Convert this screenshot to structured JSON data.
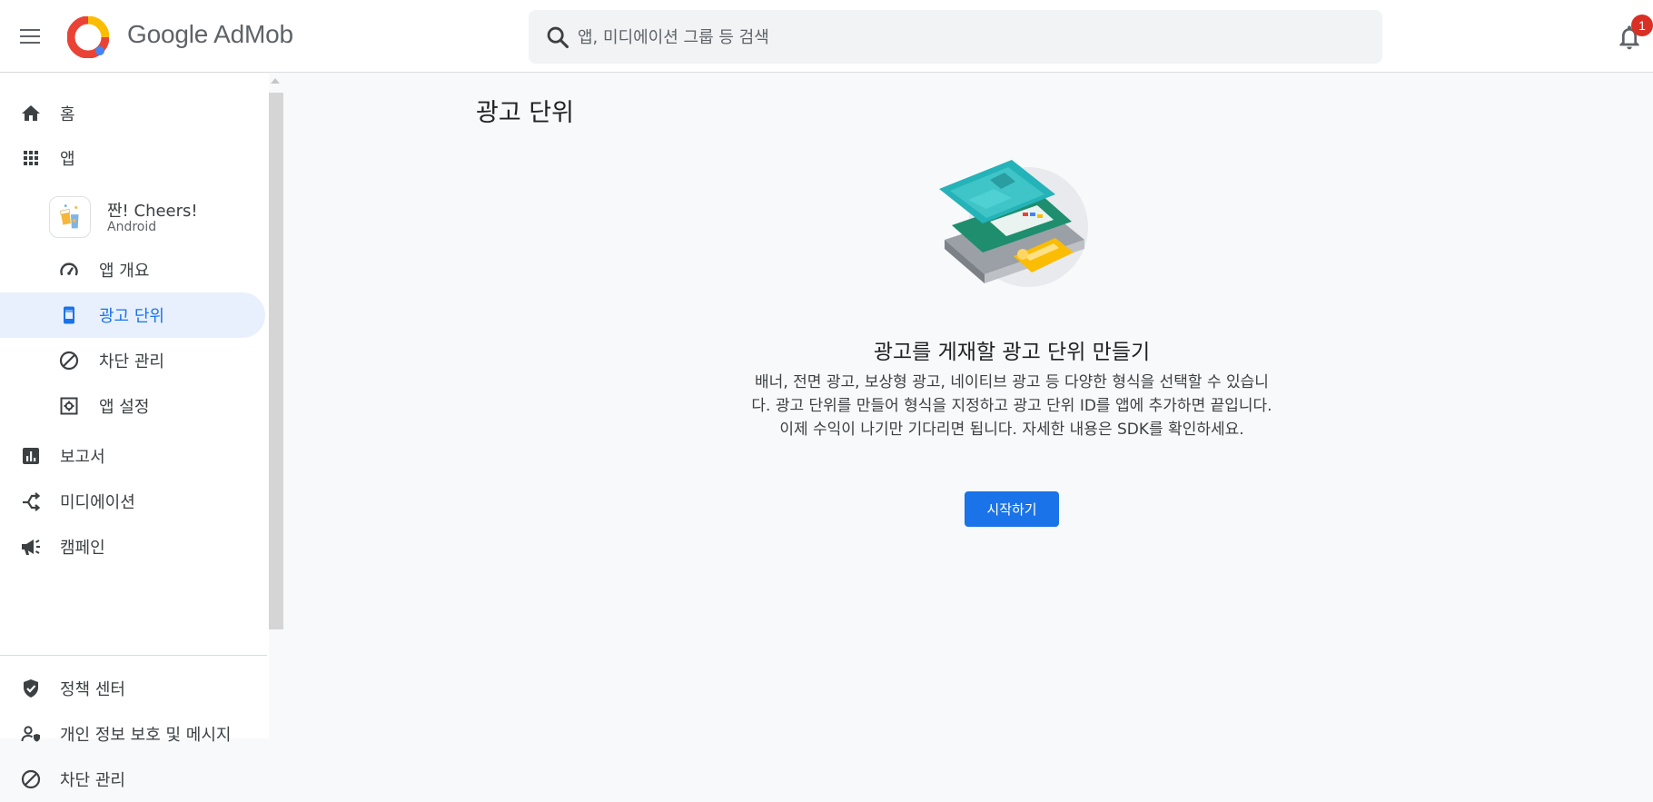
{
  "header": {
    "brand": "Google AdMob",
    "search_placeholder": "앱, 미디에이션 그룹 등 검색",
    "notification_count": "1"
  },
  "sidebar": {
    "home": "홈",
    "apps": "앱",
    "app": {
      "name": "짠! Cheers!",
      "platform": "Android"
    },
    "app_overview": "앱 개요",
    "ad_units": "광고 단위",
    "app_blocking": "차단 관리",
    "app_settings": "앱 설정",
    "reports": "보고서",
    "mediation": "미디에이션",
    "campaigns": "캠페인",
    "policy_center": "정책 센터",
    "privacy_messaging": "개인 정보 보호 및 메시지",
    "blocking": "차단 관리"
  },
  "main": {
    "page_title": "광고 단위",
    "empty_title": "광고를 게재할 광고 단위 만들기",
    "empty_desc": "배너, 전면 광고, 보상형 광고, 네이티브 광고 등 다양한 형식을 선택할 수 있습니다. 광고 단위를 만들어 형식을 지정하고 광고 단위 ID를 앱에 추가하면 끝입니다. 이제 수익이 나기만 기다리면 됩니다. 자세한 내용은 SDK를 확인하세요.",
    "start_button": "시작하기"
  },
  "colors": {
    "accent": "#1a73e8",
    "active_bg": "#e8f0fe",
    "badge": "#d93025"
  },
  "icons": [
    "menu-icon",
    "admob-logo-icon",
    "search-icon",
    "bell-icon",
    "home-icon",
    "apps-grid-icon",
    "speedometer-icon",
    "phone-icon",
    "block-icon",
    "settings-icon",
    "bar-chart-icon",
    "mediation-icon",
    "megaphone-icon",
    "shield-check-icon",
    "privacy-icon"
  ]
}
